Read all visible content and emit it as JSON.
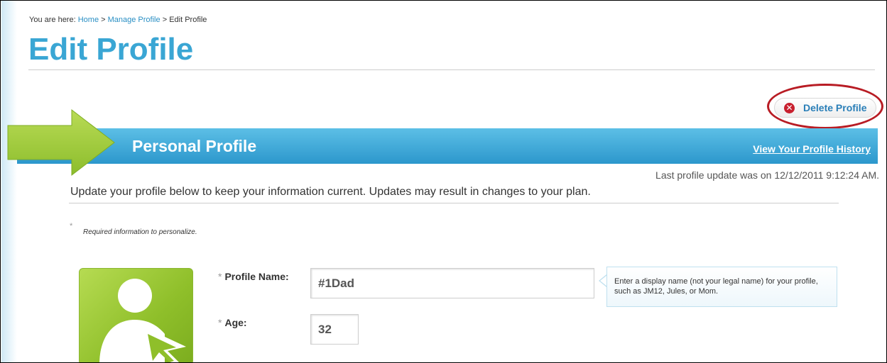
{
  "breadcrumb": {
    "prefix": "You are here:",
    "items": [
      "Home",
      "Manage Profile",
      "Edit Profile"
    ],
    "separator": ">"
  },
  "page": {
    "title": "Edit Profile"
  },
  "actions": {
    "delete_label": "Delete Profile",
    "delete_icon": "close-circle-icon"
  },
  "section": {
    "title": "Personal Profile",
    "history_link": "View Your Profile History",
    "last_update": "Last profile update was on 12/12/2011 9:12:24 AM.",
    "intro": "Update your profile below to keep your information current. Updates may result in changes to your plan.",
    "required_star": "*",
    "required_note": "Required information to personalize."
  },
  "form": {
    "profile_name": {
      "star": "*",
      "label": "Profile Name:",
      "value": "#1Dad"
    },
    "age": {
      "star": "*",
      "label": "Age:",
      "value": "32"
    },
    "tooltip": "Enter a display name (not your legal name) for your profile, such as JM12, Jules, or Mom."
  },
  "colors": {
    "accent": "#3aa6d4",
    "bar": "#2c97cc",
    "delete": "#c8202f",
    "highlight": "#b81c24",
    "arrow": "#9ec63b",
    "avatar": "#8fbf2a"
  }
}
